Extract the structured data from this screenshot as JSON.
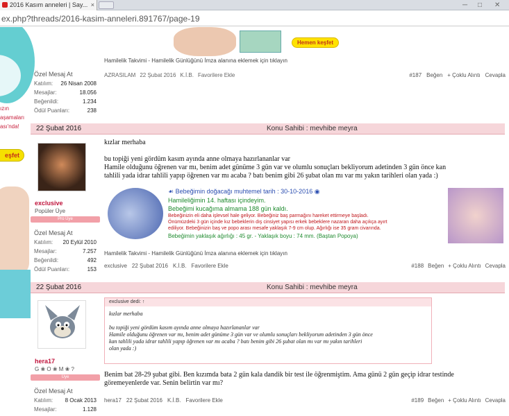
{
  "browser": {
    "tab_title": "2016 Kasım anneleri | Say...",
    "tab_close": "×",
    "url": "ex.php?threads/2016-kasim-anneleri.891767/page-19",
    "min": "─",
    "max": "□",
    "close": "✕"
  },
  "ad": {
    "left_text1": "ızın",
    "left_text2": "aşamaları",
    "left_text3": "ası'nda!",
    "left_button": "eşfet",
    "top_button": "Hemen keşfet"
  },
  "post1": {
    "signature": "Hamilelik Takvimi - Hamilelik Günlüğünü İmza alanına eklemek için tıklayın",
    "author": "AZRASILAM",
    "date": "22 Şubat 2016",
    "kib": "K.İ.B.",
    "fav": "Favorilere Ekle",
    "num": "#187",
    "like": "Beğen",
    "multi": "+ Çoklu Alıntı",
    "reply": "Cevapla"
  },
  "user0": {
    "pm": "Özel Mesaj At",
    "joined_l": "Katılım:",
    "joined": "26 Nisan 2008",
    "msgs_l": "Mesajlar:",
    "msgs": "18.056",
    "likes_l": "Beğenildi:",
    "likes": "1.234",
    "award_l": "Ödül Puanları:",
    "award": "238"
  },
  "post2": {
    "date": "22 Şubat 2016",
    "owner": "Konu Sahibi : mevhibe meyra",
    "user": {
      "name": "exclusive",
      "title": "Popüler Üye",
      "rank": "Pro Üye",
      "pm": "Özel Mesaj At",
      "joined_l": "Katılım:",
      "joined": "20 Eylül 2010",
      "msgs_l": "Mesajlar:",
      "msgs": "7.257",
      "likes_l": "Beğenildi:",
      "likes": "492",
      "award_l": "Ödül Puanları:",
      "award": "153"
    },
    "line1": "kızlar merhaba",
    "line2": "bu topiği yeni gördüm kasım ayında anne olmaya hazırlananlar var",
    "line3": "Hamile olduğunu öğrenen var mı, benim adet günüme 3 gün var ve olumlu sonuçları bekliyorum adetinden 3 gün önce kan",
    "line4": "tahlili yada idrar tahlili yapıp öğrenen var mı acaba ? batı benim gibi 26 şubat olan mı var mı yakın tarihleri olan yada :)",
    "tracker": {
      "due": "Bebeğimin doğacağı muhtemel tarih : 30-10-2016",
      "week": "Hamileliğimin 14. haftası içindeyim.",
      "days": "Bebeğimi kucağıma almama 188 gün kaldı.",
      "info1": "Bebeğinizin eli daha işlevsel hale geliyor. Bebeğiniz baş parmağını hareket ettirmeye başladı.",
      "info2": "Önümüzdeki 3 gün içinde kız bebeklerin dış cinsiyet yapısı erkek bebeklere nazaran daha açıkça ayırt",
      "info3": "ediliyor. Bebeğinizin baş ve popo arası mesafe yaklaşık 7-9 cm olup. Ağırlığı ise 35 gram civarında.",
      "size": "Bebeğimin yaklaşık ağırlığı : 45 gr. - Yaklaşık boyu : 74 mm. (Baştan Popoya)"
    },
    "signature": "Hamilelik Takvimi - Hamilelik Günlüğünü İmza alanına eklemek için tıklayın",
    "author": "exclusive",
    "sdate": "22 Şubat 2016",
    "kib": "K.İ.B.",
    "fav": "Favorilere Ekle",
    "num": "#188",
    "like": "Beğen",
    "multi": "+ Çoklu Alıntı",
    "reply": "Cevapla"
  },
  "post3": {
    "date": "22 Şubat 2016",
    "owner": "Konu Sahibi : mevhibe meyra",
    "user": {
      "name": "hera17",
      "title": "G ❀ O ❀ M ❀ ?",
      "rank": "Üye",
      "pm": "Özel Mesaj At",
      "joined_l": "Katılım:",
      "joined": "8 Ocak 2013",
      "msgs_l": "Mesajlar:",
      "msgs": "1.128"
    },
    "quote_head": "exclusive dedi: ↑",
    "q1": "kızlar merhaba",
    "q2": "bu topiği yeni gördüm kasım ayında anne olmaya hazırlananlar var",
    "q3": "Hamile olduğunu öğrenen var mı, benim adet günüme 3 gün var ve olumlu sonuçları bekliyorum adetinden 3 gün önce",
    "q4": "kan tahlili yada idrar tahlili yapıp öğrenen var mı acaba ? batı benim gibi 26 şubat olan mı var mı yakın tarihleri",
    "q5": "olan yada :)",
    "body1": "Benim bat 28-29 şubat gibi. Ben kızımda bata 2 gün kala dandik bir test ile öğrenmiştim. Ama günü 2 gün geçip idrar testinde",
    "body2": "göremeyenlerde var. Senin belirtin var mı?",
    "author": "hera17",
    "sdate": "22 Şubat 2016",
    "kib": "K.İ.B.",
    "fav": "Favorilere Ekle",
    "num": "#189",
    "like": "Beğen",
    "multi": "+ Çoklu Alıntı",
    "reply": "Cevapla"
  }
}
